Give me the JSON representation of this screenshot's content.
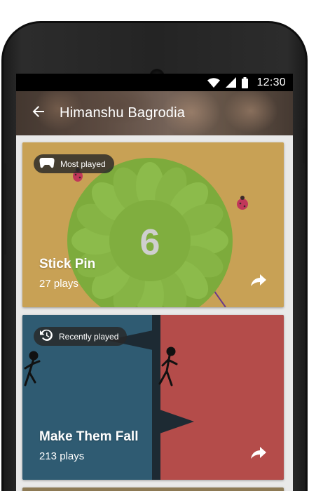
{
  "status_bar": {
    "time": "12:30",
    "icons": [
      "wifi-icon",
      "cell-signal-icon",
      "battery-icon"
    ]
  },
  "app_bar": {
    "title": "Himanshu Bagrodia",
    "back_icon": "arrow-back-icon"
  },
  "cards": [
    {
      "badge_icon": "gamepad-icon",
      "badge_label": "Most played",
      "title": "Stick Pin",
      "subtitle": "27 plays",
      "share_icon": "share-icon",
      "art_number": "6",
      "background_color": "#c7a154"
    },
    {
      "badge_icon": "history-icon",
      "badge_label": "Recently played",
      "title": "Make Them Fall",
      "subtitle": "213 plays",
      "share_icon": "share-icon",
      "background_color": "#2f5b72"
    }
  ],
  "colors": {
    "status_bar": "#000000",
    "screen_background": "#e9e9e9",
    "stick_pin_bg": "#c7a154",
    "stick_pin_wheel": "#7dab3c",
    "make_them_fall_left": "#2f5b72",
    "make_them_fall_right": "#b44c4a"
  }
}
